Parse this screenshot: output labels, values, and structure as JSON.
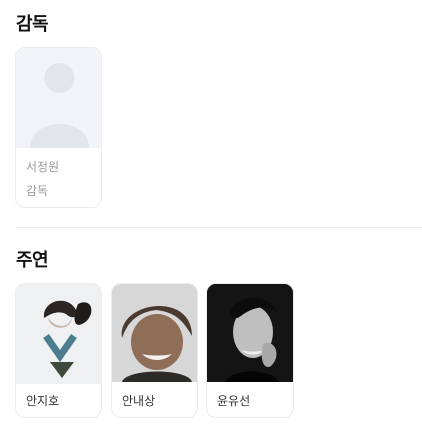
{
  "director_section": {
    "title": "감독",
    "people": [
      {
        "name": "서정원",
        "role": "감독"
      }
    ]
  },
  "cast_section": {
    "title": "주연",
    "people": [
      {
        "name": "안지호"
      },
      {
        "name": "안내상"
      },
      {
        "name": "윤유선"
      }
    ]
  }
}
